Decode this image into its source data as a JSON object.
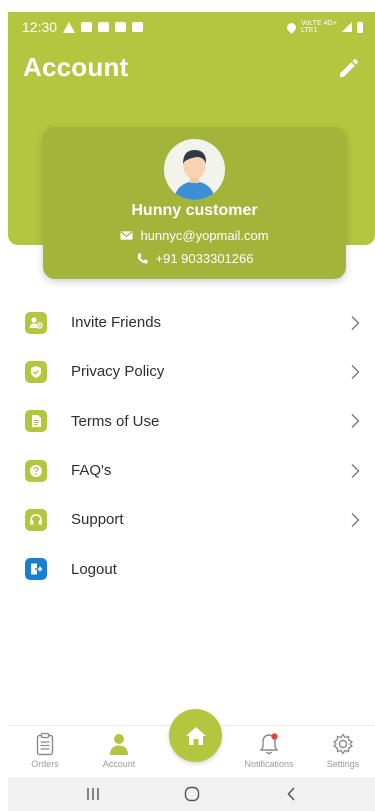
{
  "status_bar": {
    "time": "12:30",
    "net_top": "VoLTE 4G+",
    "net_bottom": "LTE1"
  },
  "header": {
    "title": "Account"
  },
  "profile": {
    "name": "Hunny customer",
    "email": "hunnyc@yopmail.com",
    "phone": "+91 9033301266"
  },
  "menu": {
    "items": [
      {
        "label": "Invite Friends",
        "icon": "invite-friends-icon"
      },
      {
        "label": "Privacy Policy",
        "icon": "shield-icon"
      },
      {
        "label": "Terms of Use",
        "icon": "document-icon"
      },
      {
        "label": "FAQ's",
        "icon": "question-icon"
      },
      {
        "label": "Support",
        "icon": "headset-icon"
      },
      {
        "label": "Logout",
        "icon": "logout-icon"
      }
    ]
  },
  "bottom_nav": {
    "orders": "Orders",
    "account": "Account",
    "notifications": "Notifications",
    "settings": "Settings"
  },
  "colors": {
    "brand_green": "#b3c640",
    "card_green": "#a3b43b",
    "logout_blue": "#1a7fd4",
    "notification_dot": "#e0473c"
  }
}
